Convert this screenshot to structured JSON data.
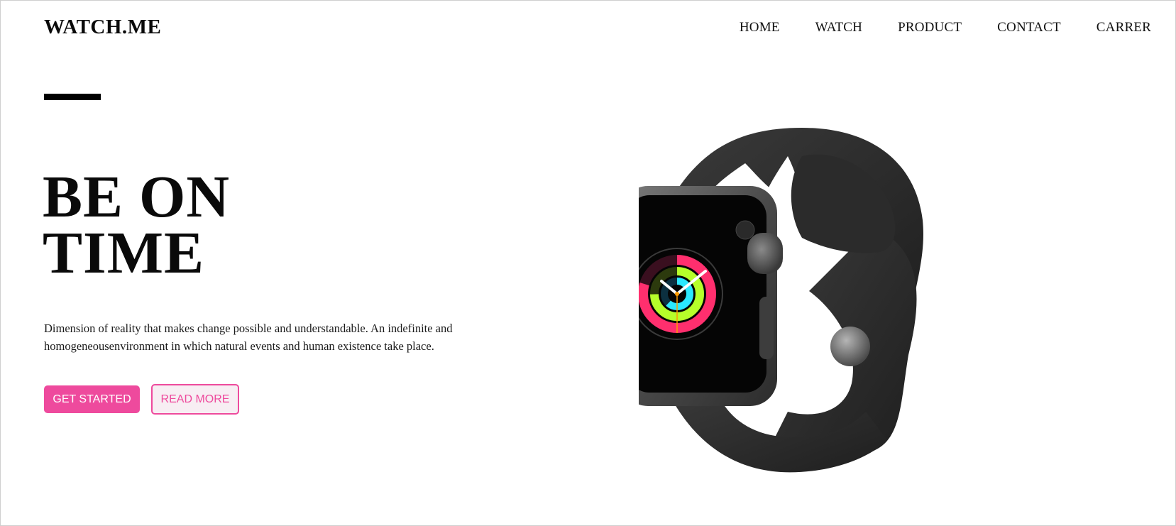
{
  "brand": {
    "logo": "WATCH.ME"
  },
  "nav": {
    "items": [
      {
        "label": "HOME"
      },
      {
        "label": "WATCH"
      },
      {
        "label": "PRODUCT"
      },
      {
        "label": "CONTACT"
      },
      {
        "label": "CARRER"
      }
    ]
  },
  "hero": {
    "headline_line1": "BE ON",
    "headline_line2": "TIME",
    "description": "Dimension of reality that makes change possible and understandable. An indefinite and homogeneousenvironment in which natural events and human existence take place.",
    "primary_cta": "GET STARTED",
    "secondary_cta": "READ MORE"
  },
  "colors": {
    "accent": "#ee4a9d",
    "text": "#111111",
    "background": "#ffffff"
  },
  "image": {
    "product": "smartwatch-image"
  }
}
